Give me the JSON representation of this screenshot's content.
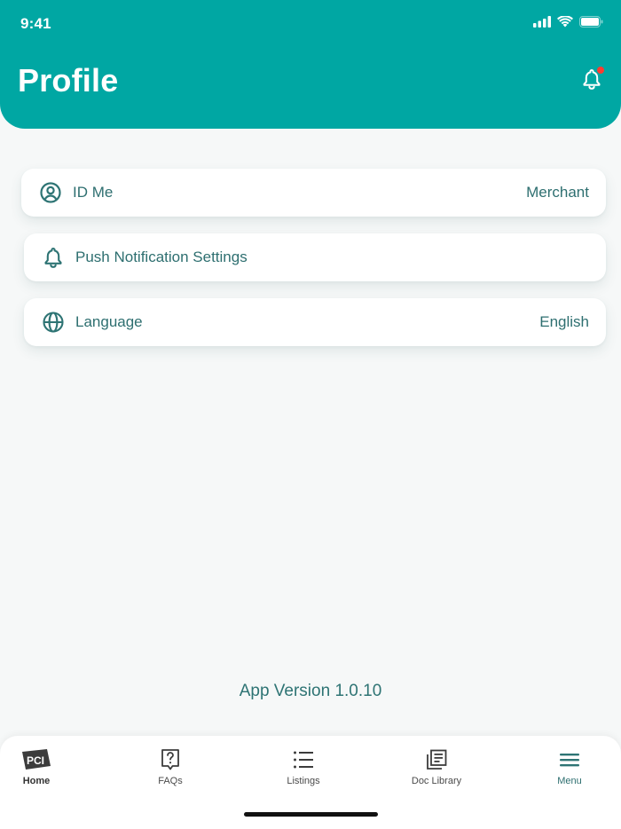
{
  "status_bar": {
    "time": "9:41"
  },
  "header": {
    "title": "Profile",
    "has_notification_badge": true
  },
  "settings": [
    {
      "label": "ID Me",
      "value": "Merchant",
      "icon": "user-circle-icon"
    },
    {
      "label": "Push Notification Settings",
      "value": "",
      "icon": "bell-icon"
    },
    {
      "label": "Language",
      "value": "English",
      "icon": "globe-icon"
    }
  ],
  "footer": {
    "version": "App Version 1.0.10"
  },
  "tabbar": {
    "items": [
      {
        "label": "Home",
        "icon": "pci-logo-icon"
      },
      {
        "label": "FAQs",
        "icon": "question-icon"
      },
      {
        "label": "Listings",
        "icon": "list-icon"
      },
      {
        "label": "Doc Library",
        "icon": "doc-library-icon"
      },
      {
        "label": "Menu",
        "icon": "menu-icon"
      }
    ]
  },
  "colors": {
    "brand": "#00a7a3",
    "text_teal": "#2e6f70",
    "notification_dot": "#ff3b30",
    "background": "#f6f8f8"
  }
}
